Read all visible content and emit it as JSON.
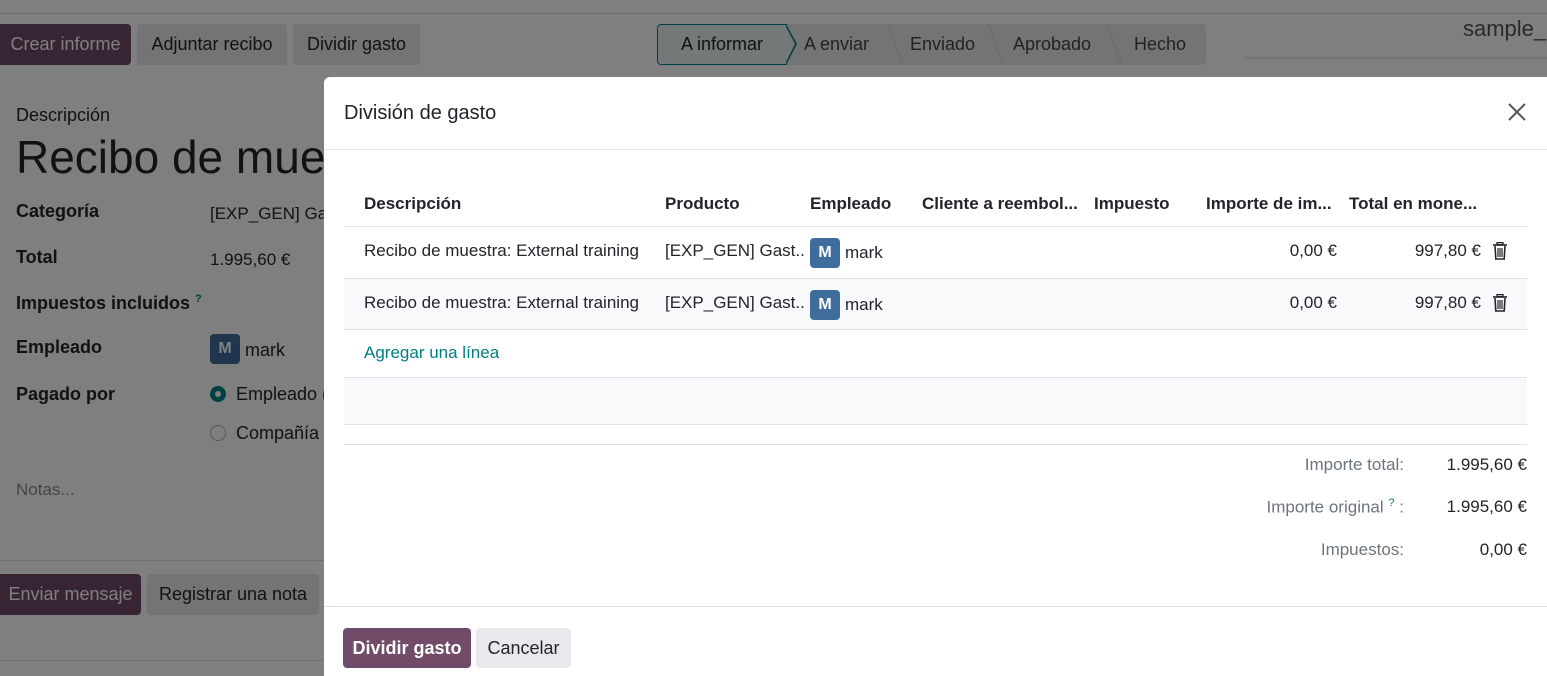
{
  "toolbar": {
    "create_report": "Crear informe",
    "attach_receipt": "Adjuntar recibo",
    "split_expense": "Dividir gasto"
  },
  "stages": [
    "A informar",
    "A enviar",
    "Enviado",
    "Aprobado",
    "Hecho"
  ],
  "record_title_short": "sample_",
  "form": {
    "description_label": "Descripción",
    "title": "Recibo de muest",
    "category_label": "Categoría",
    "category_value": "[EXP_GEN] Gas",
    "total_label": "Total",
    "total_value": "1.995,60 €",
    "taxes_included_label": "Impuestos incluidos",
    "help_mark": "?",
    "employee_label": "Empleado",
    "employee_avatar": "M",
    "employee_value": "mark",
    "paid_by_label": "Pagado por",
    "paid_by_options": [
      "Empleado (",
      "Compañía"
    ],
    "notes_placeholder": "Notas..."
  },
  "chatter": {
    "send_message": "Enviar mensaje",
    "log_note": "Registrar una nota"
  },
  "modal": {
    "title": "División de gasto",
    "columns": [
      "Descripción",
      "Producto",
      "Empleado",
      "Cliente a reembol...",
      "Impuesto",
      "Importe de im...",
      "Total en mone..."
    ],
    "rows": [
      {
        "description": "Recibo de muestra: External training",
        "product": "[EXP_GEN] Gast...",
        "employee_avatar": "M",
        "employee": "mark",
        "customer": "",
        "tax": "",
        "tax_amount": "0,00 €",
        "total": "997,80 €"
      },
      {
        "description": "Recibo de muestra: External training",
        "product": "[EXP_GEN] Gast...",
        "employee_avatar": "M",
        "employee": "mark",
        "customer": "",
        "tax": "",
        "tax_amount": "0,00 €",
        "total": "997,80 €"
      }
    ],
    "add_line": "Agregar una línea",
    "summary": {
      "total_label": "Importe total:",
      "total_value": "1.995,60 €",
      "original_label": "Importe original",
      "original_help": "?",
      "original_colon": ":",
      "original_value": "1.995,60 €",
      "taxes_label": "Impuestos:",
      "taxes_value": "0,00 €"
    },
    "confirm_button": "Dividir gasto",
    "cancel_button": "Cancelar"
  },
  "colors": {
    "primary": "#714b67",
    "accent": "#017e84",
    "avatar": "#3e6d9c"
  }
}
